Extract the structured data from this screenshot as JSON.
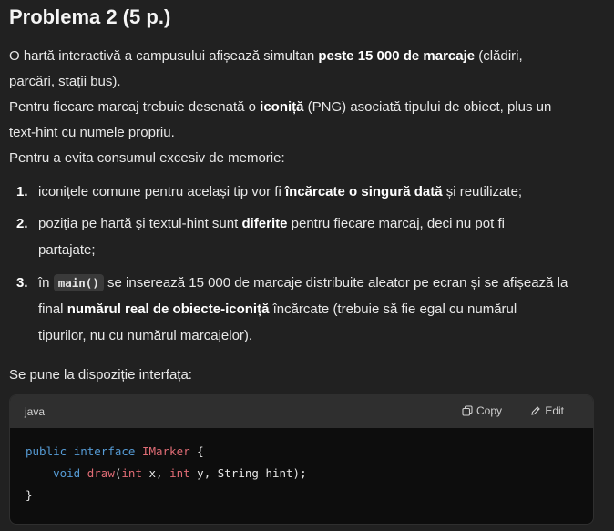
{
  "title": "Problema 2 (5 p.)",
  "intro": {
    "l1_a": "O hartă interactivă a campusului afișează simultan ",
    "l1_b": "peste 15 000 de marcaje",
    "l1_c": " (clădiri,",
    "l2": "parcări, stații bus).",
    "l3_a": "Pentru fiecare marcaj trebuie desenată o ",
    "l3_b": "iconiță",
    "l3_c": " (PNG) asociată tipului de obiect, plus un",
    "l4": "text-hint cu numele propriu.",
    "l5": "Pentru a evita consumul excesiv de memorie:"
  },
  "list": [
    {
      "num": "1.",
      "a": "iconițele comune pentru același tip vor fi ",
      "b": "încărcate o singură dată",
      "c": " și reutilizate;"
    },
    {
      "num": "2.",
      "a": "poziția pe hartă și textul-hint sunt ",
      "b": "diferite",
      "c": " pentru fiecare marcaj, deci nu pot fi",
      "d": "partajate;"
    },
    {
      "num": "3.",
      "a": "în ",
      "code": "main()",
      "b": " se inserează 15 000 de marcaje distribuite aleator pe ecran și se afișează la",
      "c": "final ",
      "d": "numărul real de obiecte-iconiță",
      "e": " încărcate (trebuie să fie egal cu numărul",
      "f": "tipurilor, nu cu numărul marcajelor)."
    }
  ],
  "outro": "Se pune la dispoziție interfața:",
  "codeblock": {
    "lang": "java",
    "copy_label": "Copy",
    "edit_label": "Edit",
    "copy_icon": "copy-icon",
    "edit_icon": "pencil-icon",
    "line1": {
      "k1": "public",
      "k2": "interface",
      "name": "IMarker",
      "rest": " {"
    },
    "line2": {
      "ret": "void",
      "fn": "draw",
      "p1t": "int",
      "p1": " x, ",
      "p2t": "int",
      "p2": " y, String hint);"
    },
    "line3": "}"
  },
  "colors": {
    "background": "#212121",
    "code_bg": "#0d0d0d",
    "keyword": "#569cd6",
    "type_name": "#e06c75"
  }
}
